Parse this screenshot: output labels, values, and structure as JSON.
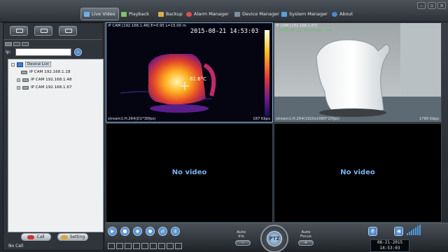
{
  "nav": {
    "tabs": [
      {
        "label": "Live Video",
        "icon": "monitor-icon",
        "active": true
      },
      {
        "label": "Playback",
        "icon": "film-icon"
      },
      {
        "label": "Backup",
        "icon": "backup-icon"
      },
      {
        "label": "Alarm Manager",
        "icon": "alarm-icon"
      },
      {
        "label": "Device Manager",
        "icon": "device-icon"
      },
      {
        "label": "System Manager",
        "icon": "system-icon"
      },
      {
        "label": "About",
        "icon": "info-icon"
      }
    ]
  },
  "sidebar": {
    "ip_label": "Ip:",
    "ip_value": "",
    "tree": {
      "root": "Device List",
      "cameras": [
        "IP CAM 192.168.1.18",
        "IP CAM 192.168.1.48",
        "IP CAM 192.168.1.67"
      ]
    },
    "call_label": "Call",
    "setting_label": "Setting",
    "status": "No Call"
  },
  "panes": {
    "p1": {
      "header": "IP CAM [192.168.1.48]  E=0.95 L=15.00 m",
      "timestamp": "2015-08-21  14:53:03",
      "temperature": "61.6°C",
      "footer_left": "stream1:H.264(D1*30fps)",
      "footer_right": "187 Kbps"
    },
    "p2": {
      "header": "IP CAM [192.168.1.67]",
      "timestamp": "2015-08-21 14:53:03 Fri",
      "footer_left": "stream1:H.264(1920x1080*25fps)",
      "footer_right": "1780 Kbps"
    },
    "p3": {
      "text": "No video"
    },
    "p4": {
      "text": "No video"
    }
  },
  "bottom": {
    "auto_iris": "Auto\nIris",
    "auto_focus": "Auto\nFocus",
    "ptz_label": "PTZ",
    "date": "08-21-2015",
    "time": "14:53:03"
  },
  "colors": {
    "accent": "#4d9be0",
    "novideo": "#7ab4f0"
  }
}
